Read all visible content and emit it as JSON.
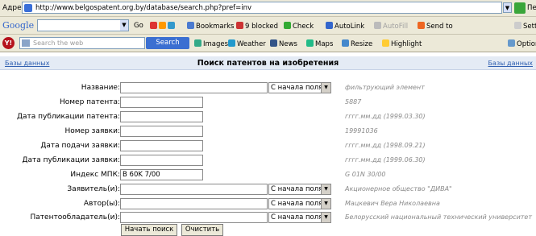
{
  "address_bar": {
    "label": "Адрес",
    "url": "http://www.belgospatent.org.by/database/search.php?pref=inv",
    "go_label": "Переход"
  },
  "google_toolbar": {
    "logo": "Google",
    "items": [
      "Go",
      "Bookmarks",
      "9 blocked",
      "Check",
      "AutoLink",
      "AutoFill",
      "Send to",
      "Settings"
    ]
  },
  "yahoo_toolbar": {
    "search_placeholder": "Search the web",
    "search_button": "Search",
    "items": [
      "Images",
      "Weather",
      "News",
      "Maps",
      "Resize",
      "Highlight",
      "Options"
    ]
  },
  "page_header": {
    "back_link": "Базы данных",
    "title": "Поиск патентов на изобретения",
    "forward_link": "Базы данных"
  },
  "form": {
    "rows": [
      {
        "label": "Название:",
        "value": "",
        "has_select": true,
        "select_value": "С начала поля",
        "hint": "фильтрующий элемент"
      },
      {
        "label": "Номер патента:",
        "value": "",
        "has_select": false,
        "hint": "5887"
      },
      {
        "label": "Дата публикации патента:",
        "value": "",
        "has_select": false,
        "hint": "гггг.мм.дд (1999.03.30)"
      },
      {
        "label": "Номер заявки:",
        "value": "",
        "has_select": false,
        "hint": "19991036"
      },
      {
        "label": "Дата подачи заявки:",
        "value": "",
        "has_select": false,
        "hint": "гггг.мм.дд (1998.09.21)"
      },
      {
        "label": "Дата публикации заявки:",
        "value": "",
        "has_select": false,
        "hint": "гггг.мм.дд (1999.06.30)"
      },
      {
        "label": "Индекс МПК:",
        "value": "B 60K 7/00",
        "has_select": false,
        "hint": "G 01N 30/00"
      },
      {
        "label": "Заявитель(и):",
        "value": "",
        "has_select": true,
        "select_value": "С начала поля",
        "hint": "Акционерное общество \"ДИВА\""
      },
      {
        "label": "Автор(ы):",
        "value": "",
        "has_select": true,
        "select_value": "С начала поля",
        "hint": "Мацкевич Вера Николаевна"
      },
      {
        "label": "Патентообладатель(и):",
        "value": "",
        "has_select": true,
        "select_value": "С начала поля",
        "hint": "Белорусский национальный технический университет"
      }
    ],
    "search_button": "Начать поиск",
    "clear_button": "Очистить"
  },
  "colors": {
    "toolbar_bg": "#ece9d8",
    "header_bg": "#e4ebf5",
    "hint_text": "#8a8a8a",
    "link": "#3060b0"
  }
}
